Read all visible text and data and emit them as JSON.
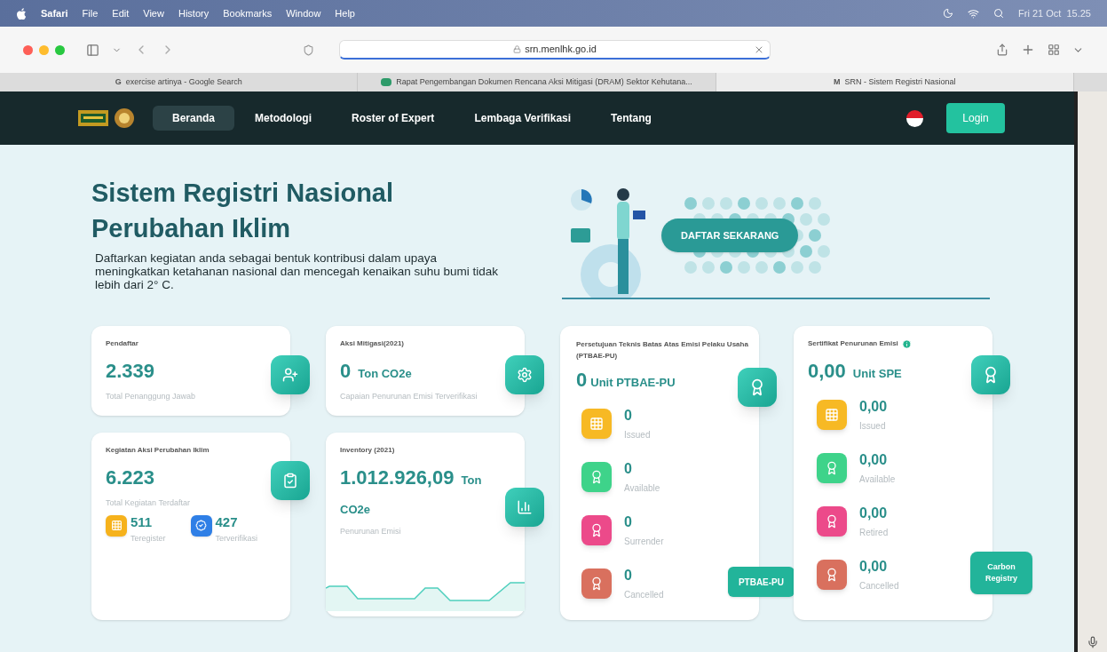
{
  "menubar": {
    "app": "Safari",
    "menus": [
      "File",
      "Edit",
      "View",
      "History",
      "Bookmarks",
      "Window",
      "Help"
    ],
    "clock": "Fri 21 Oct  15.25"
  },
  "browser": {
    "url": "srn.menlhk.go.id",
    "tabs": [
      {
        "title": "exercise artinya - Google Search",
        "icon": "G",
        "selected": false
      },
      {
        "title": "Rapat Pengembangan Dokumen Rencana Aksi Mitigasi (DRAM) Sektor Kehutana...",
        "selected": false
      },
      {
        "title": "SRN - Sistem Registri Nasional",
        "icon": "M",
        "selected": true
      }
    ]
  },
  "nav": {
    "items": [
      {
        "label": "Beranda",
        "selected": true
      },
      {
        "label": "Metodologi",
        "selected": false
      },
      {
        "label": "Roster of Expert",
        "selected": false
      },
      {
        "label": "Lembaga Verifikasi",
        "selected": false
      },
      {
        "label": "Tentang",
        "selected": false
      }
    ],
    "login": "Login"
  },
  "hero": {
    "title_lines": [
      "Sistem Registri Nasional",
      "Perubahan Iklim"
    ],
    "description": "Daftarkan kegiatan anda sebagai bentuk kontribusi dalam upaya meningkatkan ketahanan nasional dan mencegah kenaikan suhu bumi tidak lebih dari 2° C.",
    "cta": "DAFTAR SEKARANG"
  },
  "pendaftar": {
    "title": "Pendaftar",
    "value": "2.339",
    "caption": "Total Penanggung Jawab"
  },
  "aksi_mitigasi": {
    "title": "Aksi Mitigasi(2021)",
    "value": "0",
    "unit": "Ton CO2e",
    "caption": "Capaian Penurunan Emisi Terverifikasi"
  },
  "kegiatan": {
    "title": "Kegiatan Aksi Perubahan Iklim",
    "value": "6.223",
    "caption": "Total Kegiatan Terdaftar",
    "stats": [
      {
        "value": "511",
        "label": "Teregister",
        "color": "#f6b21c",
        "kind": "grid"
      },
      {
        "value": "427",
        "label": "Terverifikasi",
        "color": "#2f7fe6",
        "kind": "check"
      }
    ]
  },
  "inventory": {
    "title": "Inventory (2021)",
    "value": "1.012.926,09",
    "unit_lines": [
      "Ton",
      "CO2e"
    ],
    "caption": "Penurunan Emisi"
  },
  "ptbae": {
    "title": "Persetujuan Teknis Batas Atas Emisi Pelaku Usaha (PTBAE-PU)",
    "value": "0",
    "unit": "Unit PTBAE-PU",
    "button": "PTBAE-PU",
    "items": [
      {
        "value": "0",
        "label": "Issued",
        "color": "#f7b924",
        "kind": "grid"
      },
      {
        "value": "0",
        "label": "Available",
        "color": "#3ed38a",
        "kind": "award"
      },
      {
        "value": "0",
        "label": "Surrender",
        "color": "#ec4a8a",
        "kind": "award"
      },
      {
        "value": "0",
        "label": "Cancelled",
        "color": "#d9705e",
        "kind": "award"
      }
    ]
  },
  "spe": {
    "title": "Sertifikat Penurunan Emisi",
    "value": "0,00",
    "unit": "Unit SPE",
    "button": "Carbon Registry",
    "items": [
      {
        "value": "0,00",
        "label": "Issued",
        "color": "#f7b924",
        "kind": "grid"
      },
      {
        "value": "0,00",
        "label": "Available",
        "color": "#3ed38a",
        "kind": "award"
      },
      {
        "value": "0,00",
        "label": "Retired",
        "color": "#ec4a8a",
        "kind": "award"
      },
      {
        "value": "0,00",
        "label": "Cancelled",
        "color": "#d9705e",
        "kind": "award"
      }
    ]
  }
}
